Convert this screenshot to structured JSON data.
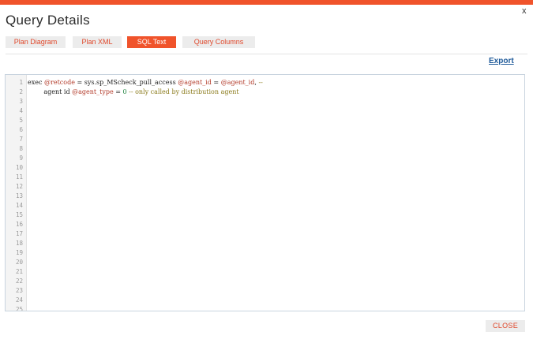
{
  "dialog": {
    "title": "Query Details",
    "close_glyph": "x",
    "accent_color": "#f0532b"
  },
  "tabs": [
    {
      "label": "Plan Diagram",
      "active": false
    },
    {
      "label": "Plan XML",
      "active": false
    },
    {
      "label": "SQL Text",
      "active": true
    },
    {
      "label": "Query Columns",
      "active": false
    }
  ],
  "export_label": "Export",
  "editor": {
    "line_numbers": [
      "1",
      "2",
      "3",
      "4",
      "5",
      "6",
      "7",
      "8",
      "9",
      "10",
      "11",
      "12",
      "13",
      "14",
      "15",
      "16",
      "17",
      "18",
      "19",
      "20",
      "21",
      "22",
      "23",
      "24",
      "25"
    ],
    "line1": {
      "kw": "exec ",
      "v1": "@retcode",
      "t1": " = sys.sp_MScheck_pull_access ",
      "v2": "@agent_id",
      "t2": " = ",
      "v3": "@agent_id",
      "t3": ", ",
      "c1": "--"
    },
    "line2": {
      "t1": "        agent id ",
      "v1": "@agent_type",
      "t2": " = ",
      "n1": "0",
      "t3": " ",
      "c1": "-- only called by distribution agent"
    }
  },
  "close_button_label": "CLOSE"
}
